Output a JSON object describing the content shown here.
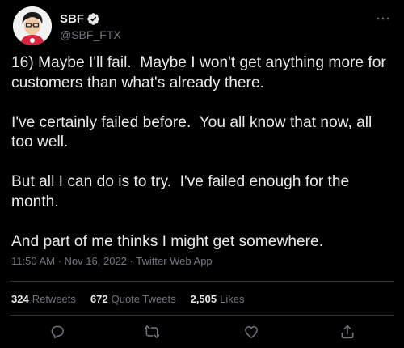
{
  "author": {
    "display_name": "SBF",
    "handle": "@SBF_FTX",
    "verified": true,
    "avatar_icon": "avatar-icon"
  },
  "tweet": {
    "paragraphs": [
      "16) Maybe I'll fail.  Maybe I won't get anything more for customers than what's already there.",
      "I've certainly failed before.  You all know that now, all too well.",
      "But all I can do is to try.  I've failed enough for the month.",
      "And part of me thinks I might get somewhere."
    ],
    "time": "11:50 AM",
    "date": "Nov 16, 2022",
    "source": "Twitter Web App"
  },
  "stats": {
    "retweets_count": "324",
    "retweets_label": "Retweets",
    "quotes_count": "672",
    "quotes_label": "Quote Tweets",
    "likes_count": "2,505",
    "likes_label": "Likes"
  },
  "icons": {
    "reply": "reply-icon",
    "retweet": "retweet-icon",
    "like": "heart-icon",
    "share": "share-icon",
    "more": "more-icon"
  },
  "colors": {
    "background": "#000000",
    "text": "#e7e9ea",
    "muted": "#71767b",
    "divider": "#2f3336",
    "verified": "#e7e9ea"
  }
}
